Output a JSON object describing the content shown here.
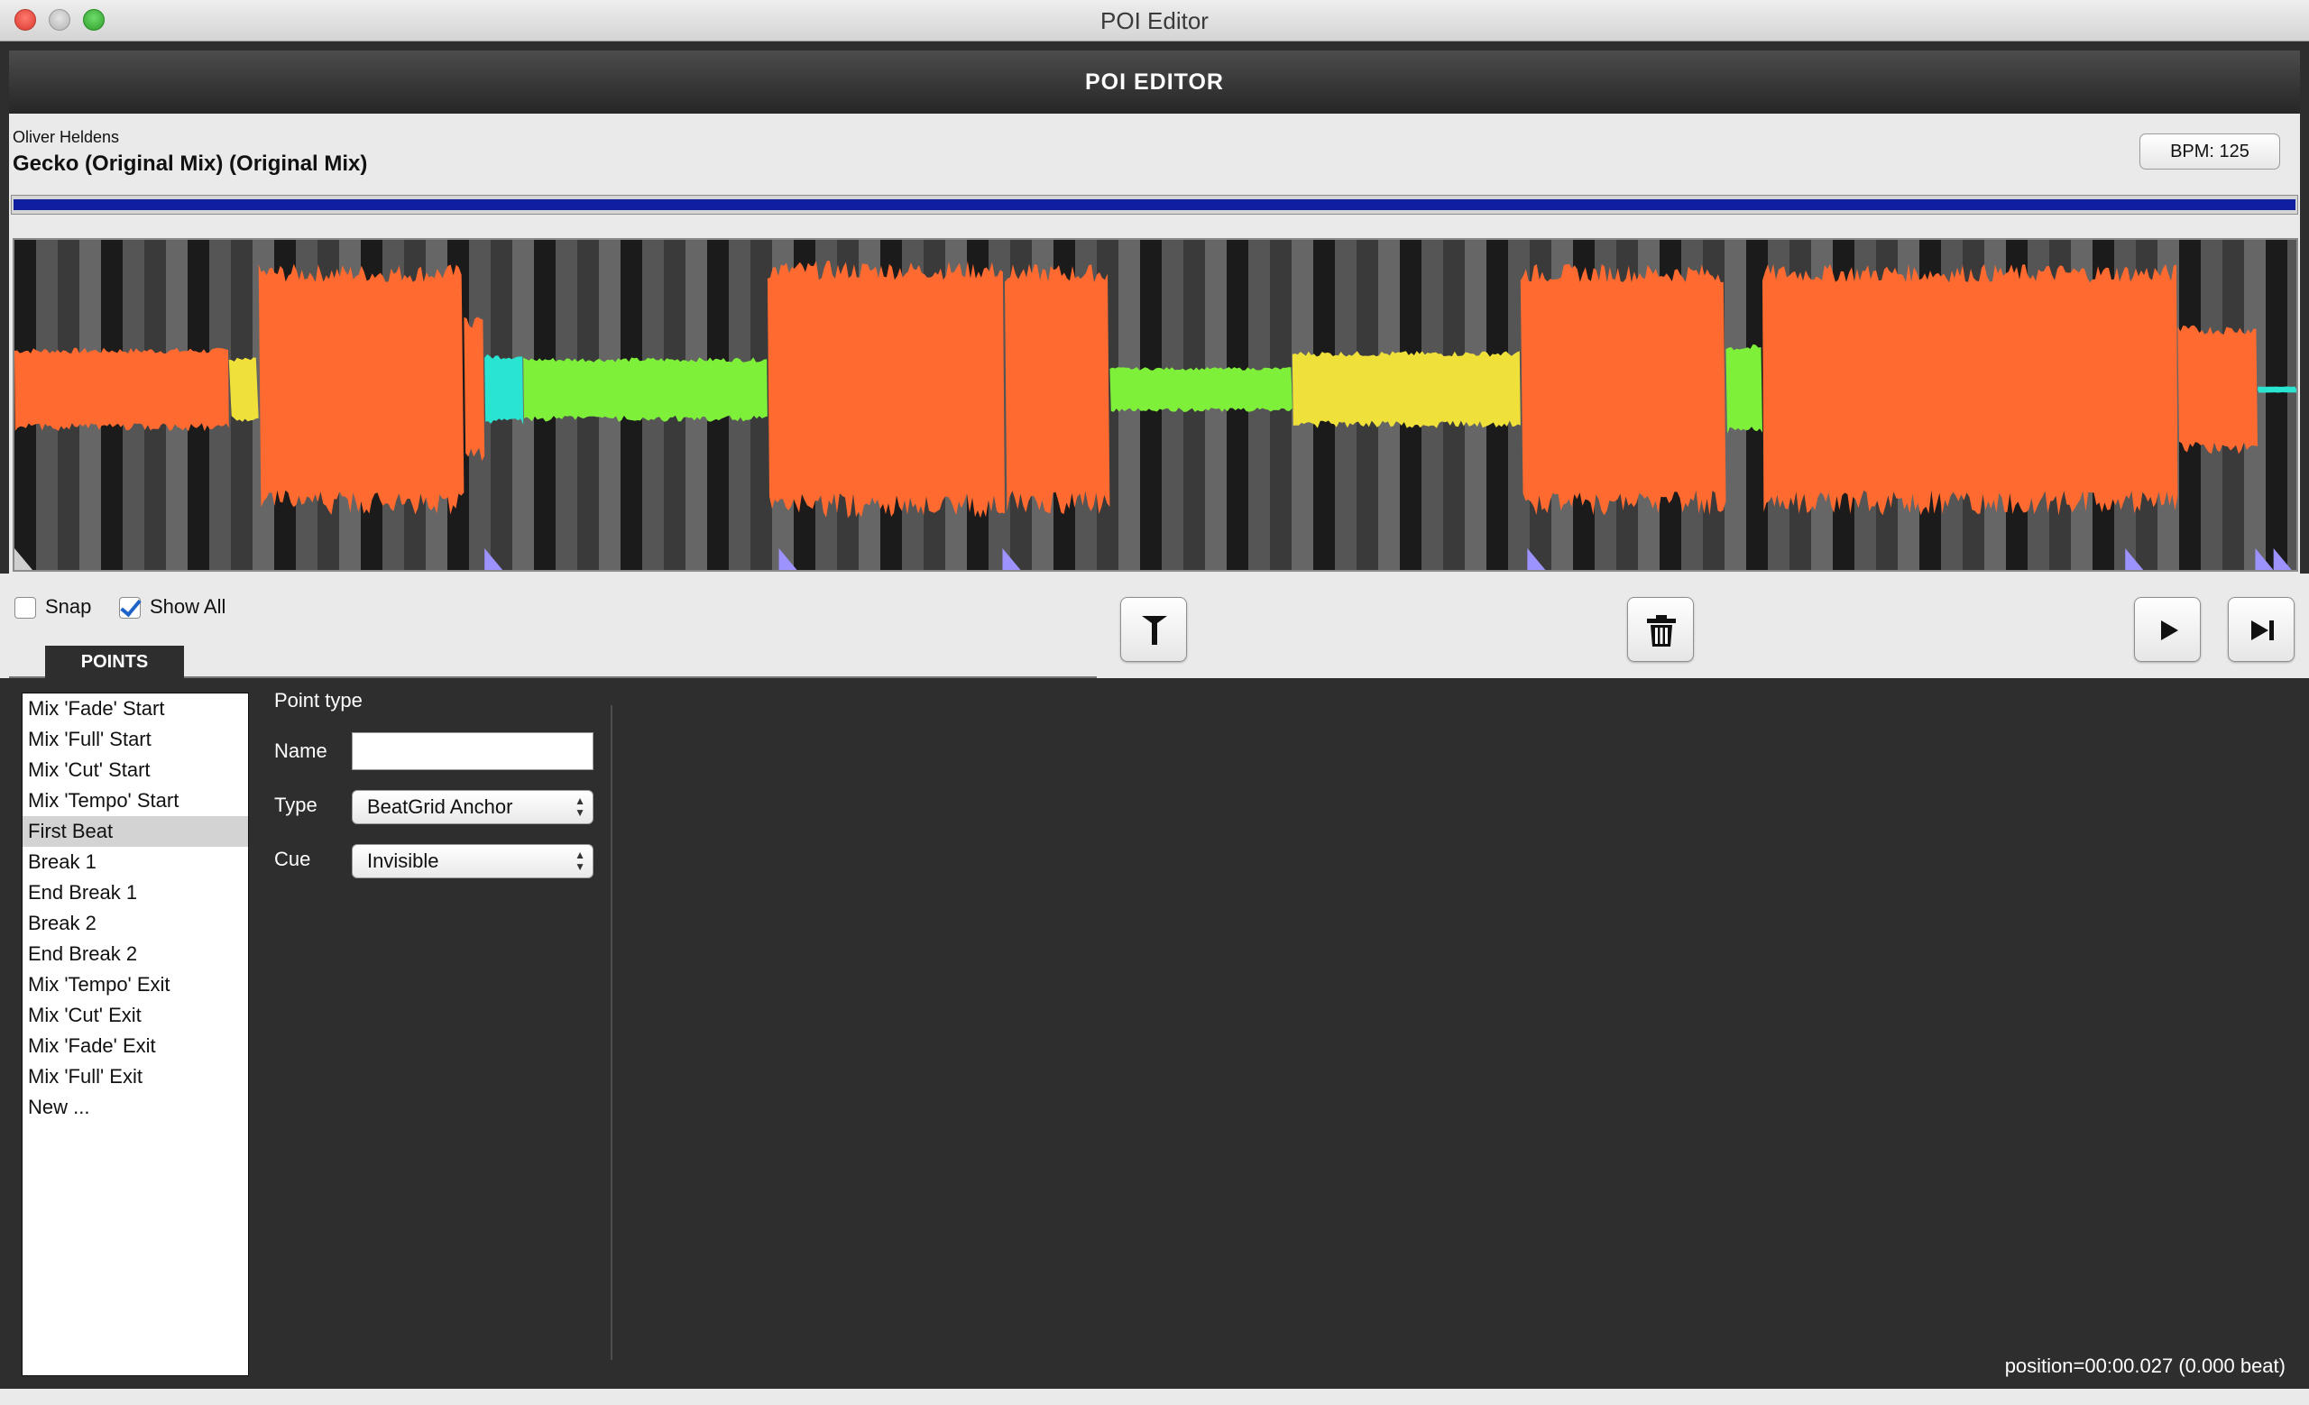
{
  "window": {
    "title": "POI Editor"
  },
  "header": {
    "title": "POI EDITOR"
  },
  "track": {
    "artist": "Oliver Heldens",
    "title": "Gecko (Original Mix) (Original Mix)",
    "bpm_label": "BPM: 125",
    "progress": 1.0,
    "progress_color": "#0f1fa0"
  },
  "waveform": {
    "colors": {
      "orange": "#ff6a30",
      "yellow": "#f0e13a",
      "green": "#7ff03a",
      "cyan": "#28e4d0",
      "marker": "#9d93ff"
    },
    "sections": [
      {
        "level": 0.26,
        "color": "orange",
        "from": 0.0,
        "to": 0.094
      },
      {
        "level": 0.2,
        "color": "yellow",
        "from": 0.094,
        "to": 0.107
      },
      {
        "level": 0.78,
        "color": "orange",
        "from": 0.107,
        "to": 0.197
      },
      {
        "level": 0.45,
        "color": "orange",
        "from": 0.197,
        "to": 0.206
      },
      {
        "level": 0.22,
        "color": "cyan",
        "from": 0.206,
        "to": 0.223
      },
      {
        "level": 0.2,
        "color": "green",
        "from": 0.223,
        "to": 0.33
      },
      {
        "level": 0.8,
        "color": "orange",
        "from": 0.33,
        "to": 0.434
      },
      {
        "level": 0.78,
        "color": "orange",
        "from": 0.434,
        "to": 0.48
      },
      {
        "level": 0.14,
        "color": "green",
        "from": 0.48,
        "to": 0.56
      },
      {
        "level": 0.24,
        "color": "yellow",
        "from": 0.56,
        "to": 0.66
      },
      {
        "level": 0.78,
        "color": "orange",
        "from": 0.66,
        "to": 0.75
      },
      {
        "level": 0.28,
        "color": "green",
        "from": 0.75,
        "to": 0.766
      },
      {
        "level": 0.78,
        "color": "orange",
        "from": 0.766,
        "to": 0.948
      },
      {
        "level": 0.4,
        "color": "orange",
        "from": 0.948,
        "to": 0.983
      },
      {
        "level": 0.02,
        "color": "cyan",
        "from": 0.983,
        "to": 1.0
      }
    ],
    "markers": [
      0.0,
      0.206,
      0.335,
      0.433,
      0.663,
      0.925,
      0.982,
      0.99
    ]
  },
  "controls": {
    "snap": {
      "label": "Snap",
      "checked": false
    },
    "show_all": {
      "label": "Show All",
      "checked": true
    },
    "tab_label": "POINTS"
  },
  "points": [
    "Mix 'Fade' Start",
    "Mix 'Full' Start",
    "Mix 'Cut' Start",
    "Mix 'Tempo' Start",
    "First Beat",
    "Break 1",
    "End Break 1",
    "Break 2",
    "End Break 2",
    "Mix 'Tempo' Exit",
    "Mix 'Cut' Exit",
    "Mix 'Fade' Exit",
    "Mix 'Full' Exit",
    "New ..."
  ],
  "selected_point_index": 4,
  "form": {
    "heading": "Point type",
    "name_label": "Name",
    "name_value": "",
    "type_label": "Type",
    "type_value": "BeatGrid Anchor",
    "cue_label": "Cue",
    "cue_value": "Invisible"
  },
  "status": {
    "position": "position=00:00.027 (0.000 beat)"
  }
}
